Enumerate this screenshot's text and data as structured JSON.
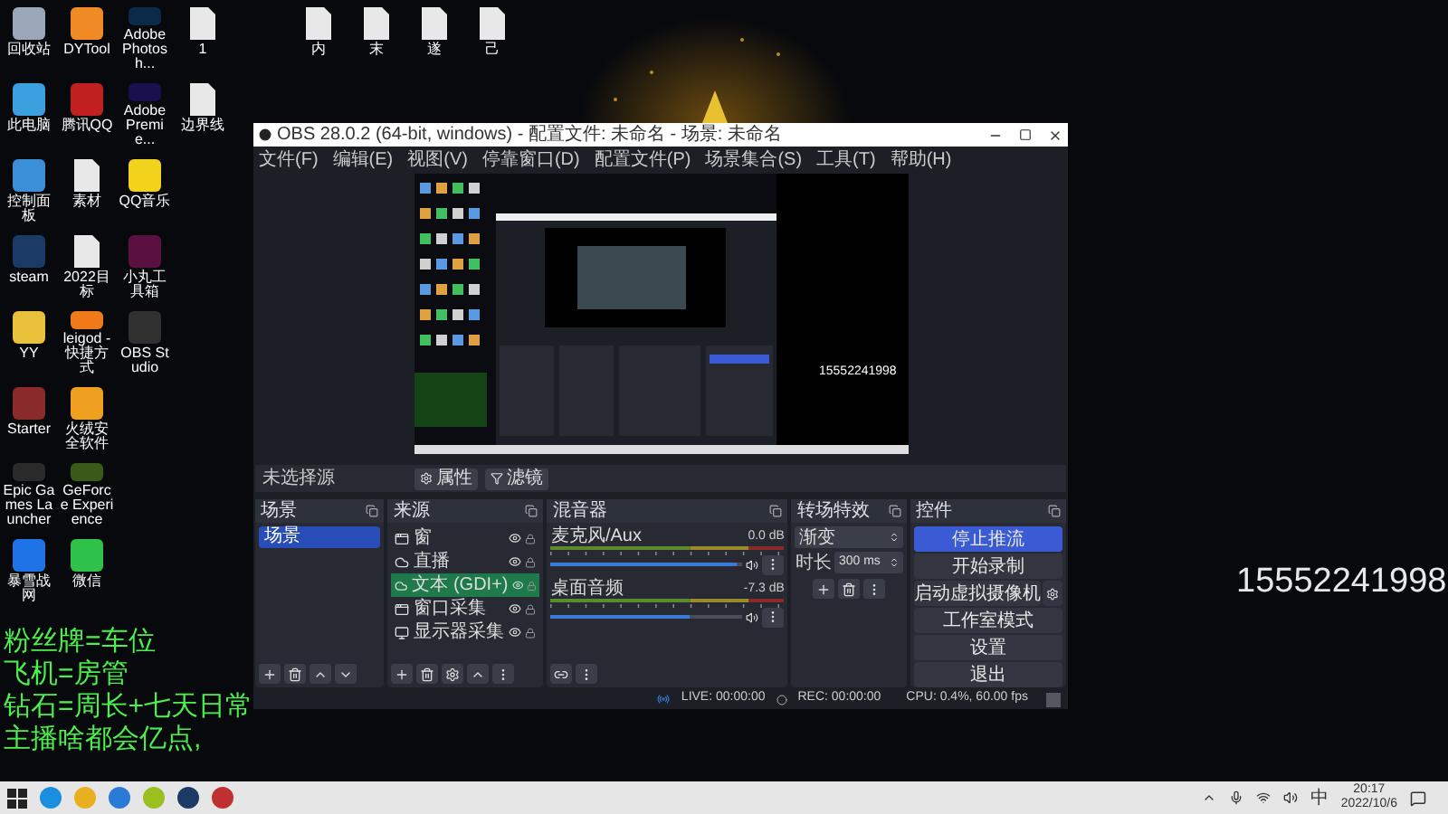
{
  "desktop": {
    "top_files": [
      "内",
      "末",
      "遂",
      "己"
    ],
    "columns": [
      [
        {
          "label": "回收站",
          "kind": "app",
          "color": "#9aa7b8"
        },
        {
          "label": "此电脑",
          "kind": "app",
          "color": "#3aa0e0"
        },
        {
          "label": "控制面板",
          "kind": "app",
          "color": "#3a8fd8"
        },
        {
          "label": "steam",
          "kind": "app",
          "color": "#1b3a66"
        },
        {
          "label": "YY",
          "kind": "app",
          "color": "#e8c03a"
        },
        {
          "label": "Starter",
          "kind": "app",
          "color": "#8a2a2a"
        },
        {
          "label": "Epic Games Launcher",
          "kind": "app",
          "color": "#2a2a2a"
        },
        {
          "label": "暴雪战网",
          "kind": "app",
          "color": "#1f73e6"
        }
      ],
      [
        {
          "label": "DYTool",
          "kind": "app",
          "color": "#f08a24"
        },
        {
          "label": "腾讯QQ",
          "kind": "app",
          "color": "#c02020"
        },
        {
          "label": "素材",
          "kind": "file"
        },
        {
          "label": "2022目标",
          "kind": "file"
        },
        {
          "label": "leigod - 快捷方式",
          "kind": "app",
          "color": "#f07a1a"
        },
        {
          "label": "火绒安全软件",
          "kind": "app",
          "color": "#f0a020"
        },
        {
          "label": "GeForce Experience",
          "kind": "app",
          "color": "#3a5a1a"
        },
        {
          "label": "微信",
          "kind": "app",
          "color": "#2ec24a"
        }
      ],
      [
        {
          "label": "Adobe Photosh...",
          "kind": "app",
          "color": "#0b2a4a"
        },
        {
          "label": "Adobe Premie...",
          "kind": "app",
          "color": "#1a1050"
        },
        {
          "label": "QQ音乐",
          "kind": "app",
          "color": "#f2d21a"
        },
        {
          "label": "小丸工具箱",
          "kind": "app",
          "color": "#5a1040"
        },
        {
          "label": "OBS Studio",
          "kind": "app",
          "color": "#303030"
        }
      ],
      [
        {
          "label": "1",
          "kind": "file"
        },
        {
          "label": "边界线",
          "kind": "file"
        }
      ]
    ]
  },
  "obs": {
    "title": "OBS 28.0.2 (64-bit, windows) - 配置文件: 未命名 - 场景: 未命名",
    "menu": [
      "文件(F)",
      "编辑(E)",
      "视图(V)",
      "停靠窗口(D)",
      "配置文件(P)",
      "场景集合(S)",
      "工具(T)",
      "帮助(H)"
    ],
    "preview": {
      "text": "15552241998"
    },
    "toolbar": {
      "label": "未选择源",
      "buttons": [
        "属性",
        "滤镜"
      ]
    },
    "scenes": {
      "title": "场景",
      "items": [
        {
          "label": "场景",
          "selected": true
        }
      ]
    },
    "sources": {
      "title": "来源",
      "items": [
        {
          "label": "窗",
          "kind": "window",
          "selected": false
        },
        {
          "label": "直播",
          "kind": "cloud",
          "selected": false
        },
        {
          "label": "文本 (GDI+)",
          "kind": "cloud",
          "selected": true
        },
        {
          "label": "窗口采集",
          "kind": "window",
          "selected": false
        },
        {
          "label": "显示器采集",
          "kind": "monitor",
          "selected": false
        }
      ]
    },
    "mixer": {
      "title": "混音器",
      "channels": [
        {
          "name": "麦克风/Aux",
          "reading": "0.0 dB",
          "level": 0.97
        },
        {
          "name": "桌面音频",
          "reading": "-7.3 dB",
          "level": 0.72
        }
      ]
    },
    "transitions": {
      "title": "转场特效",
      "type": "渐变",
      "duration_label": "时长",
      "duration": "300 ms"
    },
    "controls": {
      "title": "控件",
      "buttons": [
        {
          "label": "停止推流",
          "kind": "plain",
          "active": true
        },
        {
          "label": "开始录制",
          "kind": "plain",
          "active": false
        },
        {
          "label": "启动虚拟摄像机",
          "kind": "settings",
          "active": false
        },
        {
          "label": "工作室模式",
          "kind": "plain",
          "active": false
        },
        {
          "label": "设置",
          "kind": "plain",
          "active": false
        },
        {
          "label": "退出",
          "kind": "plain",
          "active": false
        }
      ]
    },
    "status": {
      "live": "LIVE: 00:00:00",
      "rec": "REC: 00:00:00",
      "cpu": "CPU: 0.4%, 60.00 fps"
    }
  },
  "desktop_number": "15552241998",
  "overlay_lines": [
    "粉丝牌=车位",
    "飞机=房管",
    "钻石=周长+七天日常",
    "主播啥都会亿点,"
  ],
  "taskbar": {
    "apps": [
      {
        "color": "#1a8fe0"
      },
      {
        "color": "#e8b020"
      },
      {
        "color": "#2a7ad8"
      },
      {
        "color": "#9ac020"
      },
      {
        "color": "#1b3a66"
      },
      {
        "color": "#c03030"
      }
    ],
    "ime": "中",
    "time": "20:17",
    "date": "2022/10/6"
  }
}
